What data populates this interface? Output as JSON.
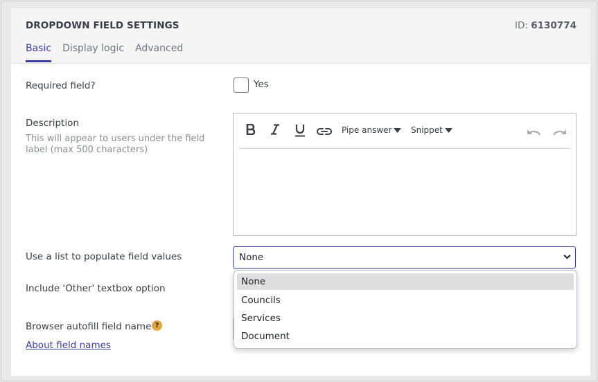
{
  "header": {
    "title": "DROPDOWN FIELD SETTINGS",
    "id_prefix": "ID:",
    "id_value": "6130774",
    "tabs": [
      {
        "label": "Basic",
        "active": true
      },
      {
        "label": "Display logic",
        "active": false
      },
      {
        "label": "Advanced",
        "active": false
      }
    ]
  },
  "required": {
    "label": "Required field?",
    "checkbox_label": "Yes",
    "checked": false
  },
  "description": {
    "label": "Description",
    "hint": "This will appear to users under the field label (max 500 characters)",
    "toolbar": {
      "bold_icon": "bold-icon",
      "italic_icon": "italic-icon",
      "underline_icon": "underline-icon",
      "link_icon": "link-icon",
      "pipe_answer": "Pipe answer",
      "snippet": "Snippet",
      "undo_icon": "undo-icon",
      "redo_icon": "redo-icon"
    },
    "content": ""
  },
  "list": {
    "label": "Use a list to populate field values",
    "selected": "None",
    "options": [
      "None",
      "Councils",
      "Services",
      "Document"
    ]
  },
  "other": {
    "label": "Include 'Other' textbox option"
  },
  "autofill": {
    "label": "Browser autofill field name",
    "help_icon": "?",
    "link": "About field names"
  },
  "colors": {
    "accent": "#3a3fa5",
    "help": "#e0a63c"
  }
}
